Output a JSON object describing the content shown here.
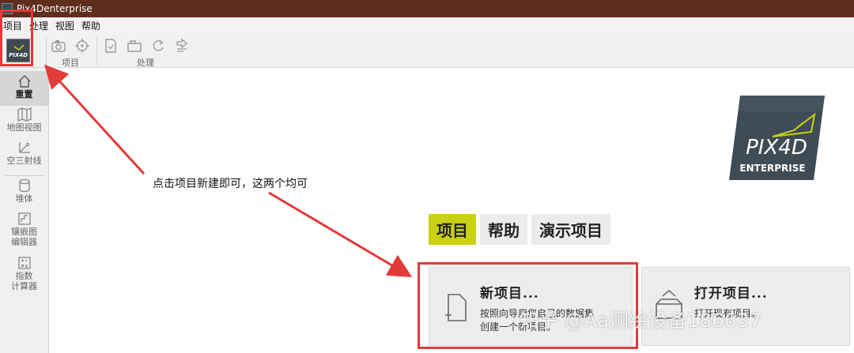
{
  "window": {
    "title": "Pix4Denterprise"
  },
  "menu": {
    "items": [
      "项目",
      "处理",
      "视图",
      "帮助"
    ]
  },
  "toolbar": {
    "groups": [
      {
        "label": "项目"
      },
      {
        "label": "处理"
      }
    ]
  },
  "sidebar": {
    "items": [
      {
        "label": "重置"
      },
      {
        "label": "地图视图"
      },
      {
        "label": "空三射线"
      },
      {
        "label": "堆体"
      },
      {
        "label_line1": "镶嵌图",
        "label_line2": "编辑器"
      },
      {
        "label_line1": "指数",
        "label_line2": "计算器"
      }
    ]
  },
  "logo": {
    "brand": "PIX4D",
    "edition": "ENTERPRISE"
  },
  "tabs": [
    {
      "label": "项目",
      "active": true
    },
    {
      "label": "帮助",
      "active": false
    },
    {
      "label": "演示项目",
      "active": false
    }
  ],
  "cards": {
    "new_project": {
      "title": "新项目...",
      "desc": "按照向导用您自己的数据集创建一个新项目。"
    },
    "open_project": {
      "title": "打开项目...",
      "desc": "打开现有项目。"
    }
  },
  "annotation": {
    "text": "点击项目新建即可，这两个均可"
  },
  "watermark": {
    "text": "知乎 @Aa测绘设备186637"
  },
  "colors": {
    "titlebar": "#5e2e1c",
    "active_tab": "#c8d212",
    "annotation_red": "#e33a3a"
  }
}
